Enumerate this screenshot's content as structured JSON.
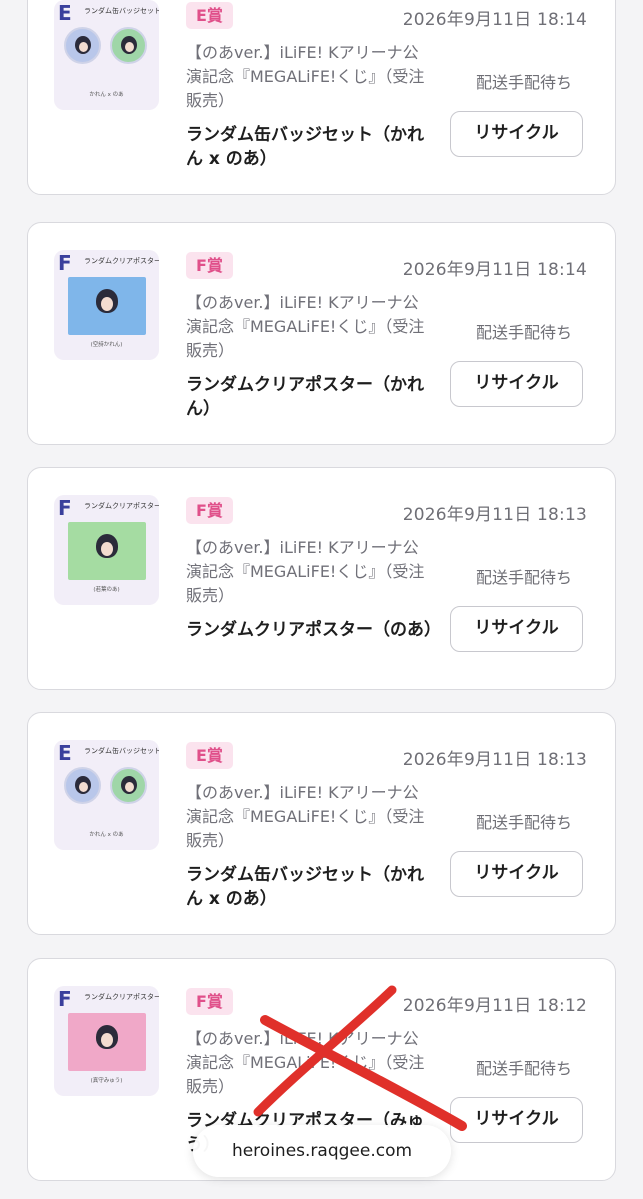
{
  "cards": [
    {
      "prize": "E賞",
      "date": "2026年9月11日 18:14",
      "event": "【のあver.】iLiFE! Kアリーナ公演記念『MEGALiFE!くじ』（受注販売）",
      "item": "ランダム缶バッジセット（かれん x のあ）",
      "status": "配送手配待ち",
      "button": "リサイクル",
      "thumb": {
        "mark": "E",
        "title": "ランダム缶バッジセット",
        "caption": "かれん x のあ",
        "kind": "badges",
        "color1": "#b9c7ea",
        "color2": "#9fd6a8"
      }
    },
    {
      "prize": "F賞",
      "date": "2026年9月11日 18:14",
      "event": "【のあver.】iLiFE! Kアリーナ公演記念『MEGALiFE!くじ』（受注販売）",
      "item": "ランダムクリアポスター（かれん）",
      "status": "配送手配待ち",
      "button": "リサイクル",
      "thumb": {
        "mark": "F",
        "title": "ランダムクリアポスター",
        "caption": "(空詩かれん)",
        "kind": "poster",
        "color1": "#7fb6ea"
      }
    },
    {
      "prize": "F賞",
      "date": "2026年9月11日 18:13",
      "event": "【のあver.】iLiFE! Kアリーナ公演記念『MEGALiFE!くじ』（受注販売）",
      "item": "ランダムクリアポスター（のあ）",
      "status": "配送手配待ち",
      "button": "リサイクル",
      "thumb": {
        "mark": "F",
        "title": "ランダムクリアポスター",
        "caption": "(若葉のあ)",
        "kind": "poster",
        "color1": "#a5dca2"
      }
    },
    {
      "prize": "E賞",
      "date": "2026年9月11日 18:13",
      "event": "【のあver.】iLiFE! Kアリーナ公演記念『MEGALiFE!くじ』（受注販売）",
      "item": "ランダム缶バッジセット（かれん x のあ）",
      "status": "配送手配待ち",
      "button": "リサイクル",
      "thumb": {
        "mark": "E",
        "title": "ランダム缶バッジセット",
        "caption": "かれん x のあ",
        "kind": "badges",
        "color1": "#b9c7ea",
        "color2": "#9fd6a8"
      }
    },
    {
      "prize": "F賞",
      "date": "2026年9月11日 18:12",
      "event": "【のあver.】iLiFE! Kアリーナ公演記念『MEGALiFE!くじ』（受注販売）",
      "item": "ランダムクリアポスター（みゅう）",
      "status": "配送手配待ち",
      "button": "リサイクル",
      "thumb": {
        "mark": "F",
        "title": "ランダムクリアポスター",
        "caption": "(真守みゅう)",
        "kind": "poster",
        "color1": "#f0a8c8"
      }
    }
  ],
  "url_bar": {
    "text": "heroines.raqgee.com"
  },
  "annotation": {
    "mark": "red-x-cross-out",
    "color": "#e0302a"
  },
  "colors": {
    "prize_bg": "#fbe3ee",
    "prize_text": "#e0508a"
  }
}
